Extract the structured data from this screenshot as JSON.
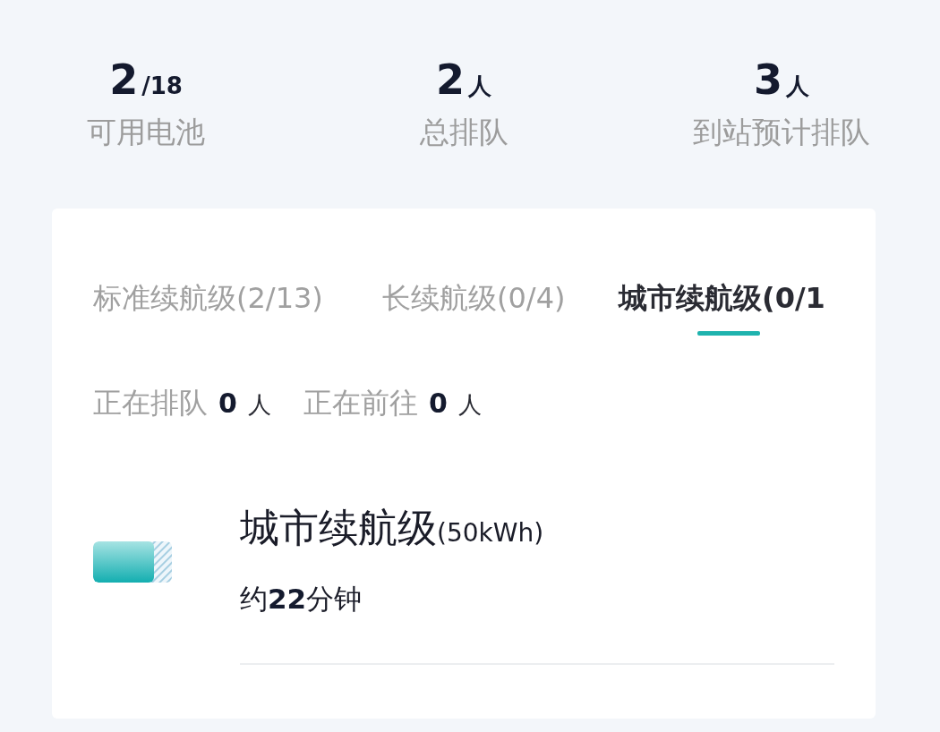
{
  "stats": [
    {
      "value": "2",
      "unit": "/18",
      "label": "可用电池"
    },
    {
      "value": "2",
      "unit": "人",
      "label": "总排队"
    },
    {
      "value": "3",
      "unit": "人",
      "label": "到站预计排队"
    }
  ],
  "card": {
    "tabs": [
      {
        "label": "标准续航级(2/13)",
        "selected": false
      },
      {
        "label": "长续航级(0/4)",
        "selected": false
      },
      {
        "label": "城市续航级(0/1",
        "selected": true
      }
    ],
    "queue_counts": [
      {
        "label": "正在排队",
        "count": "0",
        "unit": "人"
      },
      {
        "label": "正在前往",
        "count": "0",
        "unit": "人"
      }
    ],
    "battery": {
      "name": "城市续航级",
      "capacity": "(50kWh)",
      "estimate": "约**22**分钟"
    }
  }
}
